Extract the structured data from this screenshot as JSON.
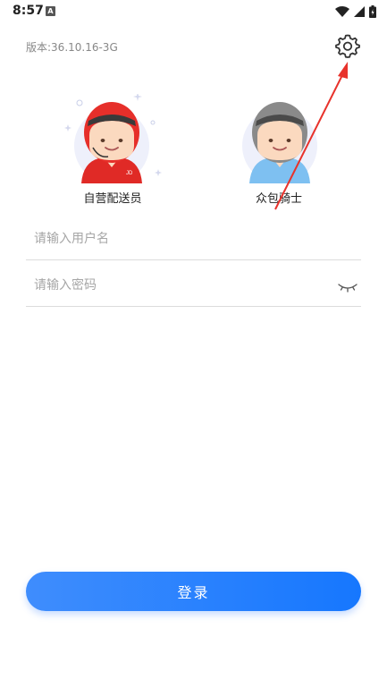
{
  "status_bar": {
    "time": "8:57",
    "notification_badge": "A"
  },
  "header": {
    "version": "版本:36.10.16-3G",
    "settings_icon": "gear-icon"
  },
  "roles": [
    {
      "label": "自营配送员",
      "icon": "courier-red-helmet-avatar"
    },
    {
      "label": "众包骑士",
      "icon": "courier-gray-helmet-avatar"
    }
  ],
  "form": {
    "username_placeholder": "请输入用户名",
    "password_placeholder": "请输入密码",
    "password_toggle_icon": "eye-closed-icon"
  },
  "login_button": "登录",
  "colors": {
    "primary": "#1677fe",
    "annotation_arrow": "#e8322b",
    "helmet_red": "#e62f2a"
  }
}
